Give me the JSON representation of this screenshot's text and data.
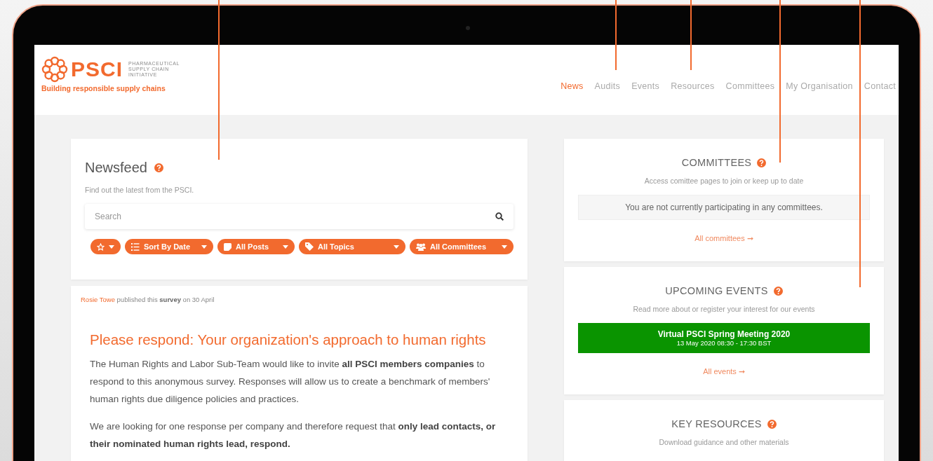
{
  "header": {
    "logo": {
      "name": "PSCI",
      "subtitle": [
        "PHARMACEUTICAL",
        "SUPPLY CHAIN",
        "INITIATIVE"
      ],
      "tagline": "Building responsible supply chains"
    },
    "nav": [
      {
        "label": "News",
        "selected": true
      },
      {
        "label": "Audits",
        "selected": false
      },
      {
        "label": "Events",
        "selected": false
      },
      {
        "label": "Resources",
        "selected": false
      },
      {
        "label": "Committees",
        "selected": false
      },
      {
        "label": "My Organisation",
        "selected": false
      },
      {
        "label": "Contact",
        "selected": false
      }
    ]
  },
  "newsfeed": {
    "title": "Newsfeed",
    "subtitle": "Find out the latest from the PSCI.",
    "search": {
      "placeholder": "Search"
    },
    "filters": [
      {
        "kind": "favourites"
      },
      {
        "kind": "sort",
        "label": "Sort By Date"
      },
      {
        "kind": "posts",
        "label": "All Posts"
      },
      {
        "kind": "topics",
        "label": "All Topics"
      },
      {
        "kind": "committees",
        "label": "All Committees"
      }
    ]
  },
  "post": {
    "author": "Rosie Towe",
    "byline": "published this **survey** on 30 April",
    "title": "Please respond: Your organization's approach to human rights",
    "paragraphs": [
      "The Human Rights and Labor Sub-Team would like to invite **all PSCI members companies** to respond to this anonymous survey. Responses will allow us to create a benchmark of members' human rights due diligence policies and practices.",
      "We are looking for one response per company and therefore request that **only lead contacts, or their nominated human rights lead, respond.**"
    ]
  },
  "panels": [
    {
      "kind": "committees",
      "title": "COMMITTEES",
      "subtitle": "Access comittee pages to join or keep up to date",
      "notice": "You are not currently participating in any committees.",
      "link": "All committees ➞"
    },
    {
      "kind": "events",
      "title": "UPCOMING EVENTS",
      "subtitle": "Read more about or register your interest for our events",
      "events": [
        {
          "title": "Virtual PSCI Spring Meeting 2020",
          "time": "13 May 2020 08:30 - 17:30 BST"
        }
      ],
      "link": "All events ➞"
    },
    {
      "kind": "resources",
      "title": "KEY RESOURCES",
      "subtitle": "Download guidance and other materials"
    }
  ]
}
